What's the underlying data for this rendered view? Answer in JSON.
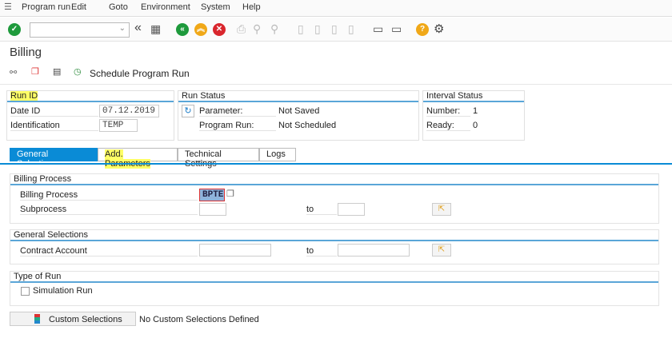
{
  "menu": [
    "Program run",
    "Edit",
    "Goto",
    "Environment",
    "System",
    "Help"
  ],
  "toolbar": {
    "icons": [
      "enter-icon",
      "back-icon",
      "save-icon",
      "back-green-icon",
      "exit-icon",
      "cancel-icon",
      "print-icon",
      "find-icon",
      "find-next-icon",
      "first-page-icon",
      "previous-page-icon",
      "next-page-icon",
      "last-page-icon",
      "create-session-icon",
      "shortcut-icon",
      "help-icon",
      "settings-icon"
    ]
  },
  "title": "Billing",
  "app_toolbar": {
    "schedule_label": "Schedule Program Run"
  },
  "run_id": {
    "header": "Run ID",
    "date_label": "Date ID",
    "date_value": "07.12.2019",
    "ident_label": "Identification",
    "ident_value": "TEMP"
  },
  "run_status": {
    "header": "Run Status",
    "param_label": "Parameter:",
    "param_value": "Not Saved",
    "run_label": "Program Run:",
    "run_value": "Not Scheduled"
  },
  "interval": {
    "header": "Interval Status",
    "number_label": "Number:",
    "number_value": "1",
    "ready_label": "Ready:",
    "ready_value": "0"
  },
  "tabs": [
    "General Selections",
    "Add. Parameters",
    "Technical Settings",
    "Logs"
  ],
  "billing": {
    "header": "Billing Process",
    "bp_label": "Billing Process",
    "bp_value": "BPTE",
    "sub_label": "Subprocess",
    "to": "to"
  },
  "general": {
    "header": "General Selections",
    "ca_label": "Contract Account",
    "to": "to"
  },
  "type_of_run": {
    "header": "Type of Run",
    "sim_label": "Simulation Run",
    "sim_checked": false
  },
  "custom": {
    "button": "Custom Selections",
    "status": "No Custom Selections Defined"
  },
  "colors": {
    "accent": "#0a8bd6",
    "highlight": "#ffff66"
  }
}
